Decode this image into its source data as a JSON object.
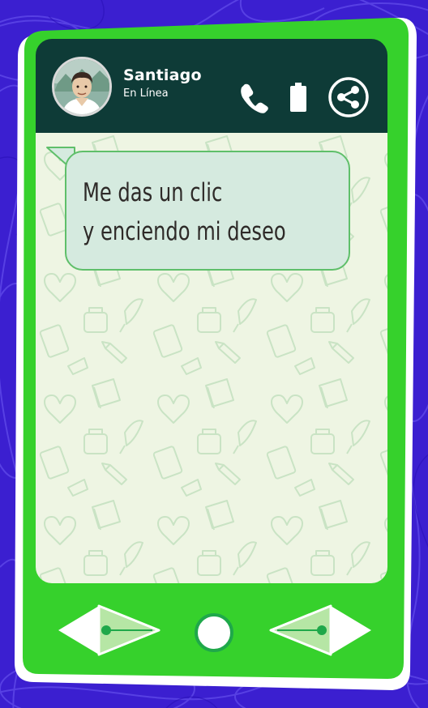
{
  "contact": {
    "name": "Santiago",
    "status": "En Línea"
  },
  "message": {
    "line1": "Me das un clic",
    "line2": "y enciendo mi deseo"
  },
  "icons": {
    "call": "phone-icon",
    "battery": "battery-icon",
    "share": "share-icon",
    "back": "arrow-left-icon",
    "home": "home-circle-icon",
    "forward": "arrow-right-icon"
  },
  "colors": {
    "background": "#3b1fd0",
    "phone_body": "#36d12c",
    "header": "#0e3b37",
    "chat_bg": "#eef5e3",
    "bubble": "#d5eadf",
    "bubble_border": "#5fbf6a"
  }
}
